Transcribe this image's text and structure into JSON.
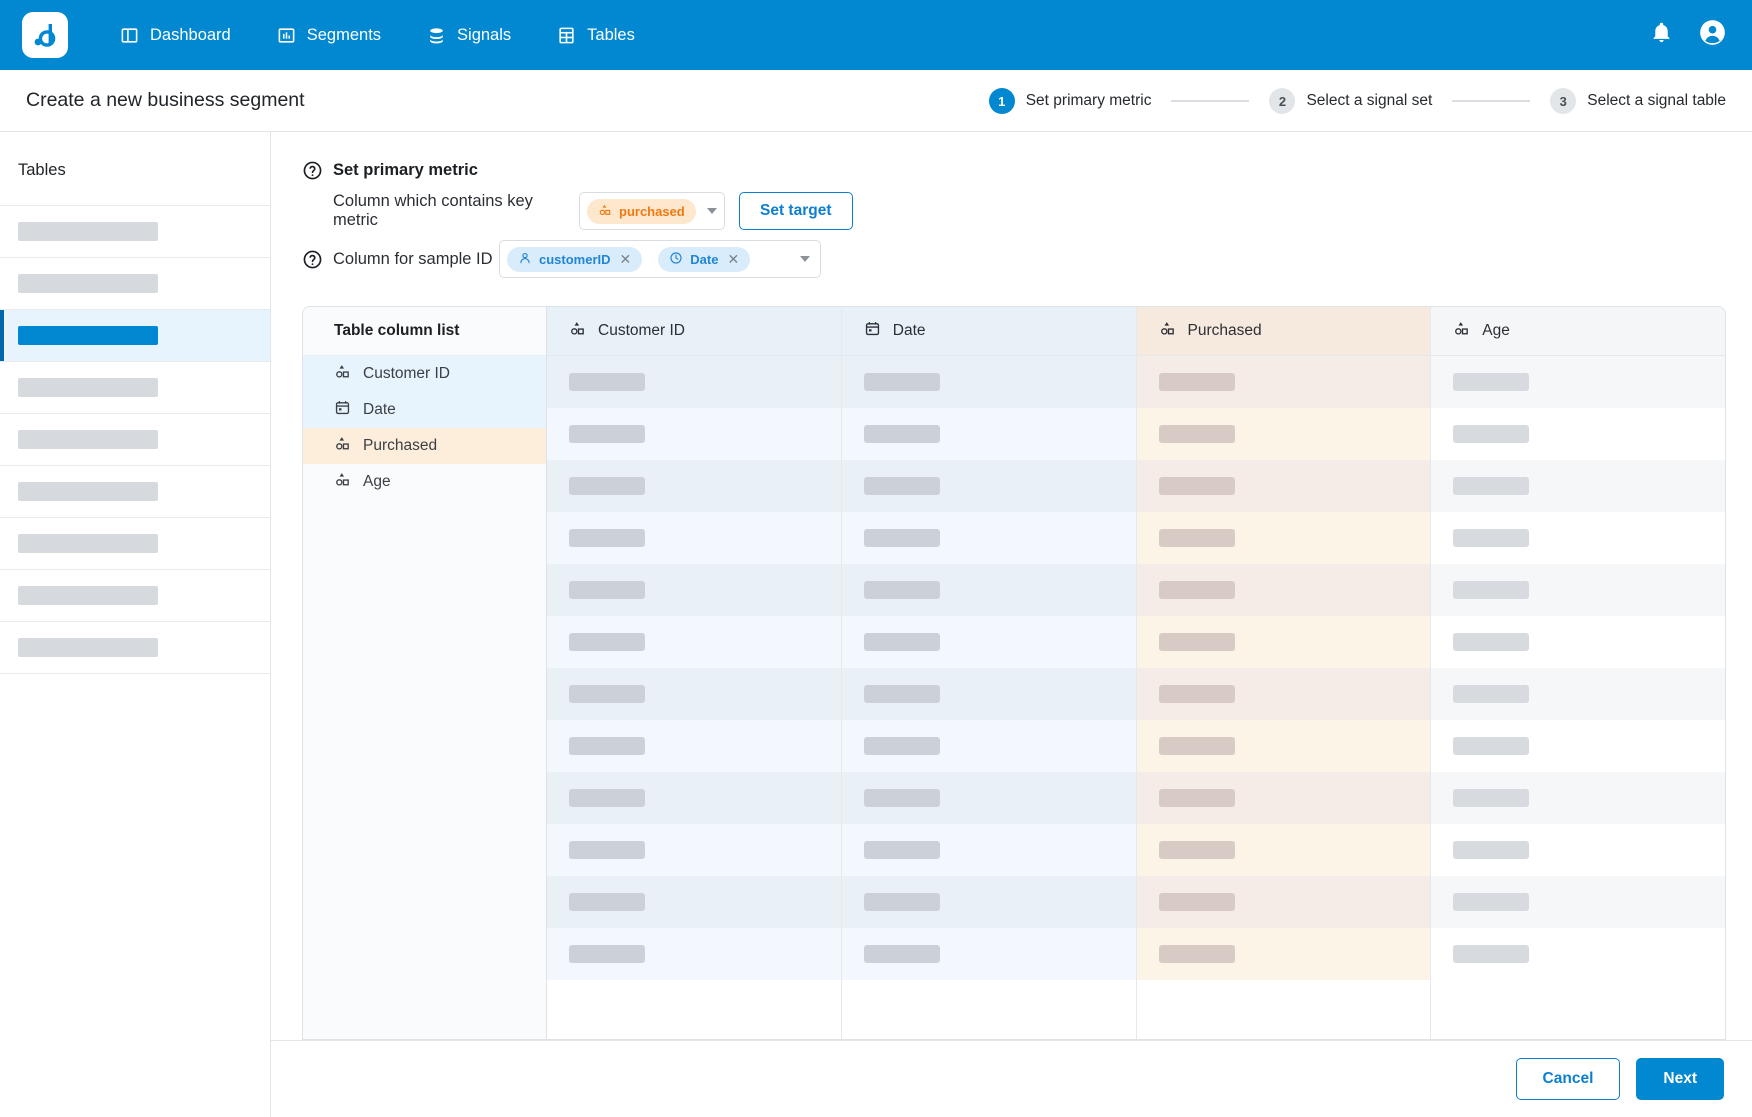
{
  "brand": {
    "logo_text": ".d",
    "accent": "#0288d1"
  },
  "topnav": {
    "items": [
      {
        "label": "Dashboard",
        "icon": "dashboard-icon"
      },
      {
        "label": "Segments",
        "icon": "bar-chart-icon"
      },
      {
        "label": "Signals",
        "icon": "database-icon"
      },
      {
        "label": "Tables",
        "icon": "table-icon"
      }
    ],
    "notification_icon": "bell-icon",
    "account_icon": "account-circle-icon"
  },
  "subheader": {
    "title": "Create a new business segment",
    "steps": [
      {
        "num": "1",
        "label": "Set primary metric",
        "state": "active"
      },
      {
        "num": "2",
        "label": "Select a signal set",
        "state": "idle"
      },
      {
        "num": "3",
        "label": "Select a signal table",
        "state": "idle"
      }
    ]
  },
  "sidebar": {
    "title": "Tables",
    "rows": [
      {
        "selected": false
      },
      {
        "selected": false
      },
      {
        "selected": true
      },
      {
        "selected": false
      },
      {
        "selected": false
      },
      {
        "selected": false
      },
      {
        "selected": false
      },
      {
        "selected": false
      },
      {
        "selected": false
      }
    ]
  },
  "form": {
    "section_title": "Set primary metric",
    "help_icon": "help-circle-icon",
    "metric": {
      "label": "Column which contains key metric",
      "chip": {
        "text": "purchased",
        "icon": "shapes-icon",
        "color": "#f07a12",
        "bg": "#fde7cd"
      },
      "caret_icon": "chevron-down-icon",
      "target_button": "Set target"
    },
    "sample": {
      "label": "Column for sample ID",
      "chips": [
        {
          "text": "customerID",
          "icon": "person-icon",
          "remove_icon": "close-icon"
        },
        {
          "text": "Date",
          "icon": "clock-icon",
          "remove_icon": "close-icon"
        }
      ],
      "caret_icon": "chevron-down-icon"
    }
  },
  "preview": {
    "collist_title": "Table column list",
    "columns": [
      {
        "label": "Customer ID",
        "icon": "shapes-icon",
        "highlight": "blue"
      },
      {
        "label": "Date",
        "icon": "calendar-icon",
        "highlight": "blue"
      },
      {
        "label": "Purchased",
        "icon": "shapes-icon",
        "highlight": "orange"
      },
      {
        "label": "Age",
        "icon": "shapes-icon",
        "highlight": "none"
      }
    ],
    "grid_columns": [
      {
        "label": "Customer ID",
        "icon": "shapes-icon",
        "head_tint": "blue",
        "body_tint": "blue"
      },
      {
        "label": "Date",
        "icon": "calendar-icon",
        "head_tint": "blue",
        "body_tint": "blue"
      },
      {
        "label": "Purchased",
        "icon": "shapes-icon",
        "head_tint": "orange",
        "body_tint": "orange"
      },
      {
        "label": "Age",
        "icon": "shapes-icon",
        "head_tint": "gray",
        "body_tint": "gray"
      }
    ],
    "row_count": 12
  },
  "footer": {
    "cancel_label": "Cancel",
    "next_label": "Next"
  }
}
